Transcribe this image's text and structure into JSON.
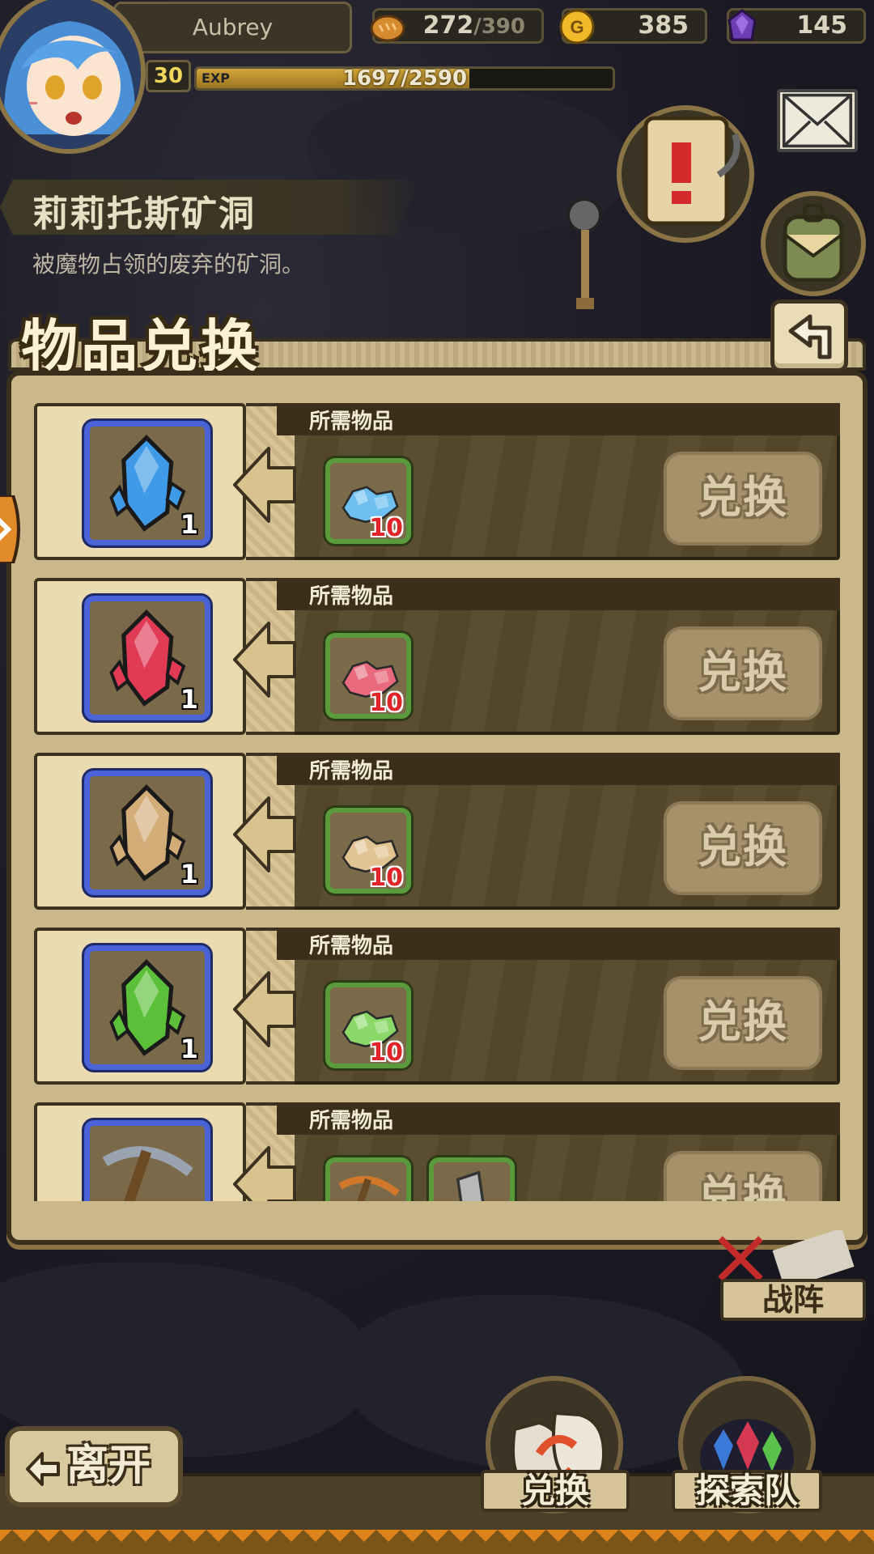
{
  "player": {
    "name": "Aubrey",
    "level": "30",
    "exp_tag": "EXP",
    "exp_current": "1697",
    "exp_max": "2590"
  },
  "resources": {
    "stamina": {
      "current": "272",
      "max": "390"
    },
    "gold": "385",
    "gems": "145"
  },
  "location": {
    "title": "莉莉托斯矿洞",
    "description": "被魔物占领的废弃的矿洞。"
  },
  "panel": {
    "title": "物品兑换"
  },
  "exchange_rows": [
    {
      "required_label": "所需物品",
      "reward": {
        "icon": "blue-crystal-icon",
        "color": "#3f9ae8",
        "quantity": "1"
      },
      "requirements": [
        {
          "icon": "blue-ore-icon",
          "color": "#6fc0f0",
          "quantity": "10"
        }
      ],
      "button": "兑换"
    },
    {
      "required_label": "所需物品",
      "reward": {
        "icon": "red-crystal-icon",
        "color": "#e03a55",
        "quantity": "1"
      },
      "requirements": [
        {
          "icon": "red-ore-icon",
          "color": "#e86a7c",
          "quantity": "10"
        }
      ],
      "button": "兑换"
    },
    {
      "required_label": "所需物品",
      "reward": {
        "icon": "tan-crystal-icon",
        "color": "#d3ad78",
        "quantity": "1"
      },
      "requirements": [
        {
          "icon": "tan-ore-icon",
          "color": "#e2c493",
          "quantity": "10"
        }
      ],
      "button": "兑换"
    },
    {
      "required_label": "所需物品",
      "reward": {
        "icon": "green-crystal-icon",
        "color": "#5cbf3a",
        "quantity": "1"
      },
      "requirements": [
        {
          "icon": "green-ore-icon",
          "color": "#8ad868",
          "quantity": "10"
        }
      ],
      "button": "兑换"
    },
    {
      "required_label": "所需物品",
      "reward": {
        "icon": "pickaxe-icon",
        "color": "#9aa4b0",
        "quantity": ""
      },
      "requirements": [
        {
          "icon": "copper-pickaxe-icon",
          "color": "#d2782a",
          "quantity": ""
        },
        {
          "icon": "iron-bar-icon",
          "color": "#b8b8b8",
          "quantity": ""
        }
      ],
      "button": "兑换"
    }
  ],
  "nav": {
    "formation": "战阵",
    "leave": "离开",
    "exchange": "兑换",
    "expedition": "探索队"
  }
}
